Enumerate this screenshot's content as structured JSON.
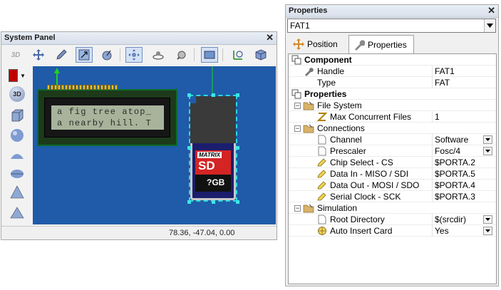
{
  "system_panel": {
    "title": "System Panel",
    "toolbar_3d_label": "3D",
    "left_3d_label": "3D",
    "lcd": {
      "line1": "a fig tree atop_",
      "line2": "a nearby hill. T"
    },
    "sd_card": {
      "brand": "MATRIX",
      "type": "SD",
      "capacity": "?GB"
    },
    "status_coords": "78.36, -47.04, 0.00"
  },
  "properties_panel": {
    "title": "Properties",
    "selected_component": "FAT1",
    "tabs": [
      "Position",
      "Properties"
    ],
    "rows": [
      {
        "kind": "cat",
        "level": 0,
        "name": "Component",
        "value": "",
        "dropdown": false,
        "icon": "component-icon"
      },
      {
        "kind": "prop",
        "level": 1,
        "name": "Handle",
        "value": "FAT1",
        "dropdown": false,
        "icon": "wrench-icon"
      },
      {
        "kind": "prop",
        "level": 1,
        "name": "Type",
        "value": "FAT",
        "dropdown": false,
        "icon": "none"
      },
      {
        "kind": "cat",
        "level": 0,
        "name": "Properties",
        "value": "",
        "dropdown": false,
        "icon": "properties-icon"
      },
      {
        "kind": "sub",
        "level": 1,
        "name": "File System",
        "value": "",
        "dropdown": false,
        "icon": "folder-icon"
      },
      {
        "kind": "prop",
        "level": 2,
        "name": "Max Concurrent Files",
        "value": "1",
        "dropdown": false,
        "icon": "z-icon"
      },
      {
        "kind": "sub",
        "level": 1,
        "name": "Connections",
        "value": "",
        "dropdown": false,
        "icon": "folder-icon"
      },
      {
        "kind": "prop",
        "level": 2,
        "name": "Channel",
        "value": "Software",
        "dropdown": true,
        "icon": "page-icon"
      },
      {
        "kind": "prop",
        "level": 2,
        "name": "Prescaler",
        "value": "Fosc/4",
        "dropdown": true,
        "icon": "page-icon"
      },
      {
        "kind": "prop",
        "level": 2,
        "name": "Chip Select - CS",
        "value": "$PORTA.2",
        "dropdown": false,
        "icon": "pencil-icon"
      },
      {
        "kind": "prop",
        "level": 2,
        "name": "Data In - MISO / SDI",
        "value": "$PORTA.5",
        "dropdown": false,
        "icon": "pencil-icon"
      },
      {
        "kind": "prop",
        "level": 2,
        "name": "Data Out - MOSI / SDO",
        "value": "$PORTA.4",
        "dropdown": false,
        "icon": "pencil-icon"
      },
      {
        "kind": "prop",
        "level": 2,
        "name": "Serial Clock - SCK",
        "value": "$PORTA.3",
        "dropdown": false,
        "icon": "pencil-icon"
      },
      {
        "kind": "sub",
        "level": 1,
        "name": "Simulation",
        "value": "",
        "dropdown": false,
        "icon": "folder-icon"
      },
      {
        "kind": "prop",
        "level": 2,
        "name": "Root Directory",
        "value": "$(srcdir)",
        "dropdown": true,
        "icon": "page-icon"
      },
      {
        "kind": "prop",
        "level": 2,
        "name": "Auto Insert Card",
        "value": "Yes",
        "dropdown": true,
        "icon": "crosshair-icon"
      }
    ]
  },
  "colors": {
    "canvas_blue": "#1f5ba8",
    "selection_cyan": "#2ed9d9",
    "color_swatch": "#c00000"
  }
}
